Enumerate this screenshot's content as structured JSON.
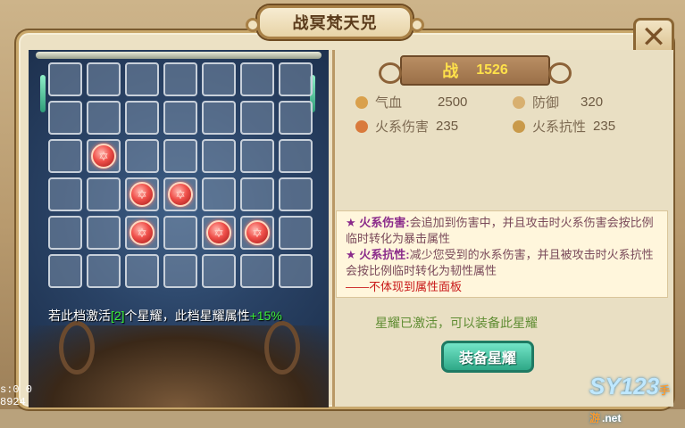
{
  "window": {
    "title": "战冥梵天兕",
    "close_label": "✕"
  },
  "power": {
    "label": "战",
    "value": "1526"
  },
  "stats": [
    {
      "label": "气血",
      "value": "2500",
      "icon": "blood-drop-icon"
    },
    {
      "label": "防御",
      "value": "320",
      "icon": "shield-ring-icon"
    },
    {
      "label": "火系伤害",
      "value": "235",
      "icon": "fire-damage-icon"
    },
    {
      "label": "火系抗性",
      "value": "235",
      "icon": "fire-resist-icon"
    }
  ],
  "grid": {
    "rows": 6,
    "cols": 7,
    "gems": [
      [
        2,
        1
      ],
      [
        3,
        2
      ],
      [
        3,
        3
      ],
      [
        4,
        2
      ],
      [
        4,
        4
      ],
      [
        4,
        5
      ]
    ]
  },
  "hint": {
    "prefix": "若此档激活",
    "count": "[2]",
    "mid": "个星耀，此档星耀属性",
    "bonus": "+15%"
  },
  "desc": {
    "line1_title": "★ 火系伤害:",
    "line1_text": "会追加到伤害中，并且攻击时火系伤害会按比例临时转化为暴击属性",
    "line2_title": "★ 火系抗性:",
    "line2_text": "减少您受到的水系伤害，并且被攻击时火系抗性会按比例临时转化为韧性属性",
    "note": "——不体现到属性面板"
  },
  "status": {
    "activated": "星耀已激活，可以装备此星耀"
  },
  "button": {
    "equip": "装备星耀"
  },
  "debug": {
    "line1": "s:0  0",
    "line2": "8924"
  },
  "watermark": {
    "main": "SY123",
    "sub": "手游",
    "net": ".net"
  },
  "colors": {
    "accent_green": "#3cf038",
    "gem_red": "#f0504a",
    "button_teal": "#2ea887",
    "power_gold": "#ffe14a"
  }
}
